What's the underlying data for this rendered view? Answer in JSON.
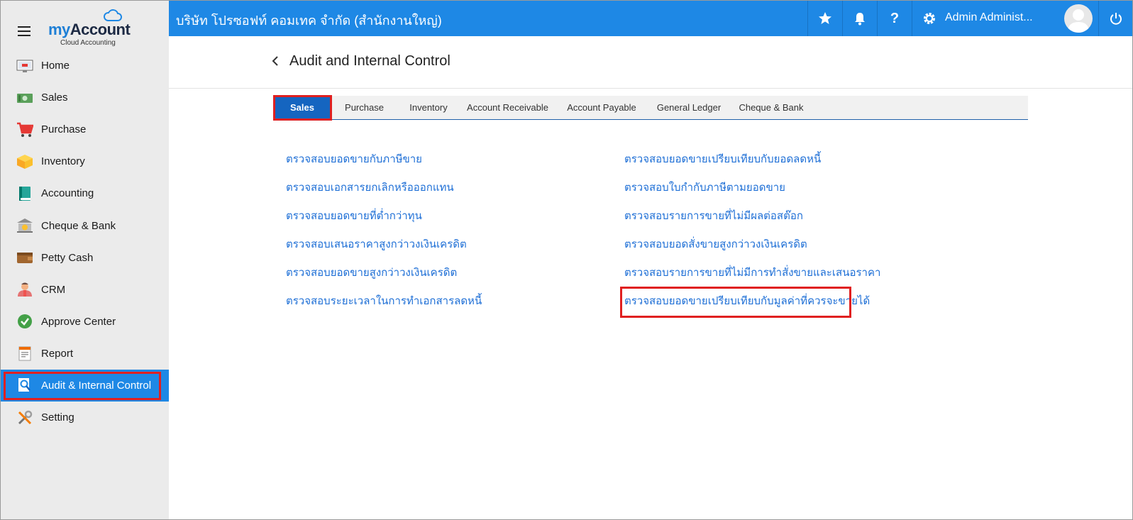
{
  "brand": {
    "logo_text_my": "my",
    "logo_text_account": "Account",
    "logo_subtitle": "Cloud Accounting"
  },
  "sidebar": {
    "items": [
      {
        "label": "Home",
        "icon": "home-icon"
      },
      {
        "label": "Sales",
        "icon": "sales-icon"
      },
      {
        "label": "Purchase",
        "icon": "cart-icon"
      },
      {
        "label": "Inventory",
        "icon": "box-icon"
      },
      {
        "label": "Accounting",
        "icon": "book-icon"
      },
      {
        "label": "Cheque & Bank",
        "icon": "bank-icon"
      },
      {
        "label": "Petty Cash",
        "icon": "wallet-icon"
      },
      {
        "label": "CRM",
        "icon": "people-icon"
      },
      {
        "label": "Approve Center",
        "icon": "check-icon"
      },
      {
        "label": "Report",
        "icon": "report-icon"
      },
      {
        "label": "Audit & Internal Control",
        "icon": "audit-icon",
        "active": true
      },
      {
        "label": "Setting",
        "icon": "tools-icon"
      }
    ]
  },
  "header": {
    "company": "บริษัท โปรซอฟท์ คอมเทค จำกัด (สำนักงานใหญ่)",
    "user_name": "Admin Administ..."
  },
  "page": {
    "title": "Audit and Internal Control"
  },
  "tabs": [
    {
      "label": "Sales",
      "active": true
    },
    {
      "label": "Purchase"
    },
    {
      "label": "Inventory"
    },
    {
      "label": "Account Receivable"
    },
    {
      "label": "Account Payable"
    },
    {
      "label": "General Ledger"
    },
    {
      "label": "Cheque & Bank"
    }
  ],
  "links": {
    "left": [
      "ตรวจสอบยอดขายกับภาษีขาย",
      "ตรวจสอบเอกสารยกเลิกหรือออกแทน",
      "ตรวจสอบยอดขายที่ต่ำกว่าทุน",
      "ตรวจสอบเสนอราคาสูงกว่าวงเงินเครดิต",
      "ตรวจสอบยอดขายสูงกว่าวงเงินเครดิต",
      "ตรวจสอบระยะเวลาในการทำเอกสารลดหนี้"
    ],
    "right": [
      "ตรวจสอบยอดขายเปรียบเทียบกับยอดลดหนี้",
      "ตรวจสอบใบกำกับภาษีตามยอดขาย",
      "ตรวจสอบรายการขายที่ไม่มีผลต่อสต๊อก",
      "ตรวจสอบยอดสั่งขายสูงกว่าวงเงินเครดิต",
      "ตรวจสอบรายการขายที่ไม่มีการทำสั่งขายและเสนอราคา",
      "ตรวจสอบยอดขายเปรียบเทียบกับมูลค่าที่ควรจะขายได้"
    ]
  },
  "colors": {
    "primary": "#1e88e5",
    "highlight": "#e02020",
    "link": "#1e6fd6",
    "tab_active": "#1565c0"
  }
}
